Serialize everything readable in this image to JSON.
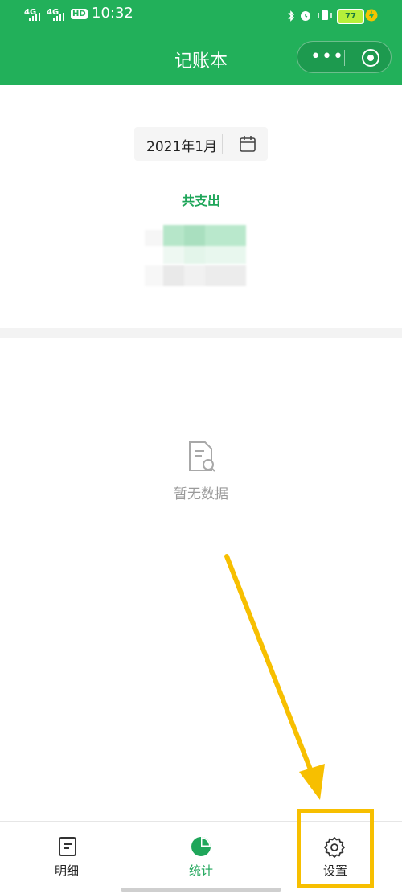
{
  "status_bar": {
    "signal1": "4G",
    "signal2": "4G",
    "hd": "HD",
    "time": "10:32",
    "battery": "77"
  },
  "header": {
    "title": "记账本"
  },
  "date_picker": {
    "value": "2021年1月"
  },
  "summary": {
    "total_label": "共支出"
  },
  "empty_state": {
    "text": "暂无数据"
  },
  "tabbar": {
    "items": [
      {
        "label": "明细",
        "icon": "document-icon"
      },
      {
        "label": "统计",
        "icon": "pie-chart-icon",
        "active": true
      },
      {
        "label": "设置",
        "icon": "gear-icon"
      }
    ]
  },
  "colors": {
    "brand": "#22b05a",
    "accent": "#1fa65a",
    "annotation": "#f7bf00"
  }
}
